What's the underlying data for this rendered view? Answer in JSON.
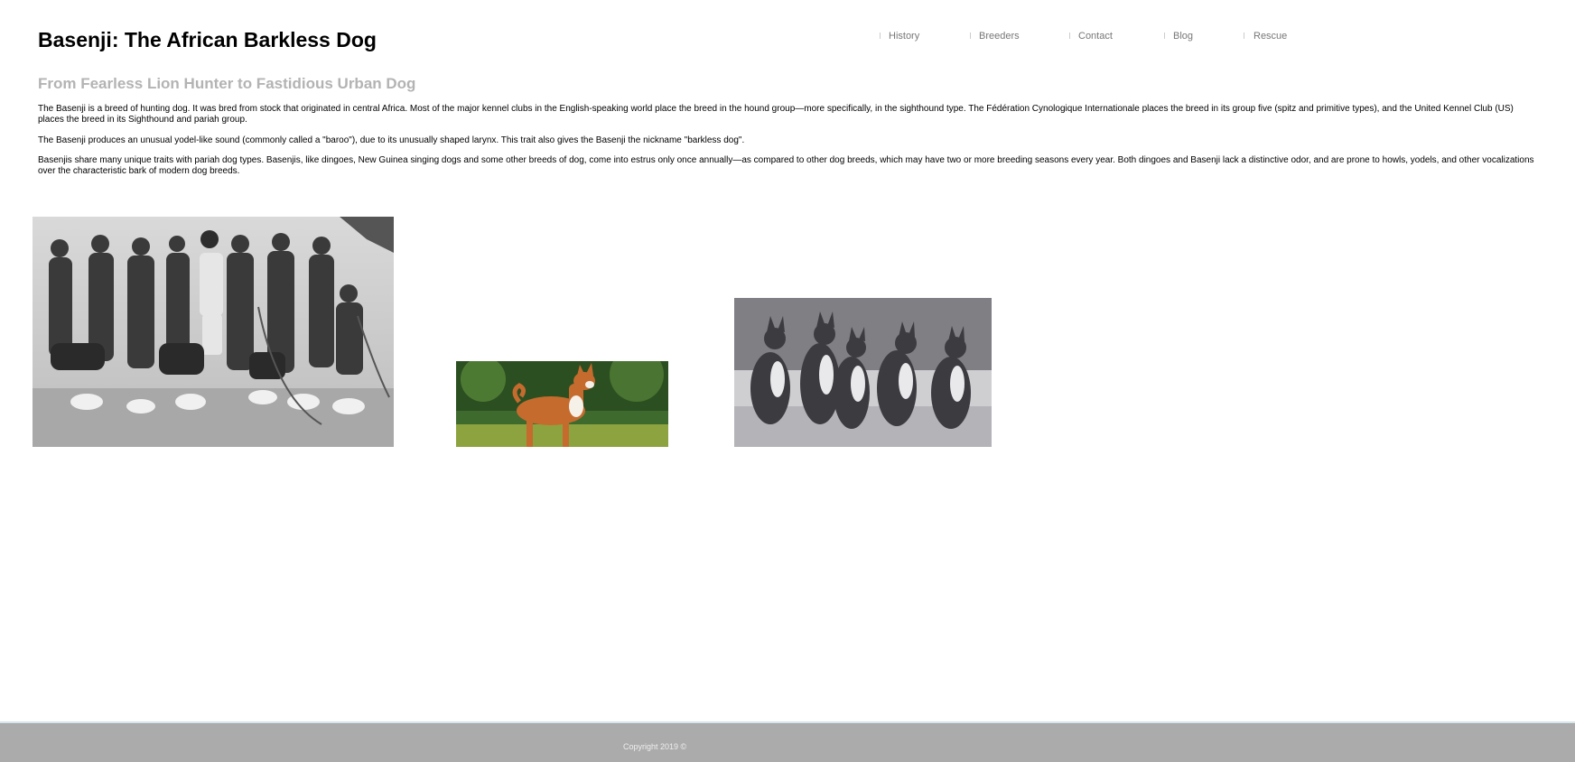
{
  "site": {
    "title": "Basenji: The African Barkless Dog"
  },
  "nav": {
    "items": [
      {
        "label": "History"
      },
      {
        "label": "Breeders"
      },
      {
        "label": "Contact"
      },
      {
        "label": "Blog"
      },
      {
        "label": "Rescue"
      }
    ],
    "text_color": "#777777",
    "separator_color": "#cccccc"
  },
  "main": {
    "subtitle": "From Fearless Lion Hunter to Fastidious Urban Dog",
    "paragraphs": [
      "The Basenji is a breed of hunting dog. It was bred from stock that originated in central Africa. Most of the major kennel clubs in the English-speaking world place the breed in the hound group—more specifically, in the sighthound type. The Fédération Cynologique Internationale places the breed in its group five (spitz and primitive types), and the United Kennel Club (US) places the breed in its Sighthound and pariah group.",
      "The Basenji produces an unusual yodel-like sound (commonly called a \"baroo\"), due to its unusually shaped larynx. This trait also gives the Basenji the nickname \"barkless dog\".",
      "Basenjis share many unique traits with pariah dog types. Basenjis, like dingoes, New Guinea singing dogs and some other breeds of dog, come into estrus only once annually—as compared to other dog breeds, which may have two or more breeding seasons every year. Both dingoes and Basenji lack a distinctive odor, and are prone to howls, yodels, and other vocalizations over the characteristic bark of modern dog breeds."
    ],
    "subtitle_color": "#b3b3b3"
  },
  "gallery": {
    "photos": [
      {
        "name": "historic-hunters-photo",
        "style": "black-and-white group photo of hunters with dogs"
      },
      {
        "name": "red-basenji-photo",
        "style": "color photo of a red and white basenji on grass"
      },
      {
        "name": "basenji-pack-photo",
        "style": "black-and-white photo of a pack of basenjis"
      }
    ]
  },
  "footer": {
    "copyright": "Copyright 2019 ©",
    "background_color": "#ababab"
  }
}
